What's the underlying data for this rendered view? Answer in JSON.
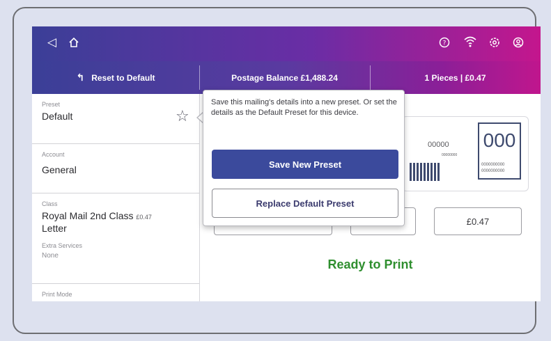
{
  "nav": {
    "back_icon": "◁",
    "home_icon": "⌂",
    "help_icon": "?",
    "wifi_icon": "wifi",
    "settings_icon": "gear",
    "account_icon": "user"
  },
  "status": {
    "reset_icon": "↰",
    "reset_label": "Reset to Default",
    "postage_balance": "Postage Balance £1,488.24",
    "pieces": "1 Pieces | £0.47"
  },
  "sidebar": {
    "preset_label": "Preset",
    "preset_value": "Default",
    "account_label": "Account",
    "account_value": "General",
    "class_label": "Class",
    "class_value": "Royal Mail 2nd Class",
    "class_price": "£0.47",
    "class_value_line2": "Letter",
    "extra_label": "Extra Services",
    "extra_value": "None",
    "print_mode_label": "Print Mode"
  },
  "stamp": {
    "big": "000",
    "digits_top": "00000",
    "digits_small": "00000000",
    "digits_row1": "0000000000",
    "digits_row2": "0000000000"
  },
  "main": {
    "amount": "£0.47",
    "ready": "Ready to Print"
  },
  "popup": {
    "text": "Save this mailing's details into a new preset. Or set the details as the Default Preset for this device.",
    "save_label": "Save New Preset",
    "replace_label": "Replace Default Preset"
  },
  "colors": {
    "header_start": "#3b3f97",
    "header_end": "#c4168d",
    "primary_button": "#3b4a9c",
    "ready": "#2f8f2f"
  }
}
